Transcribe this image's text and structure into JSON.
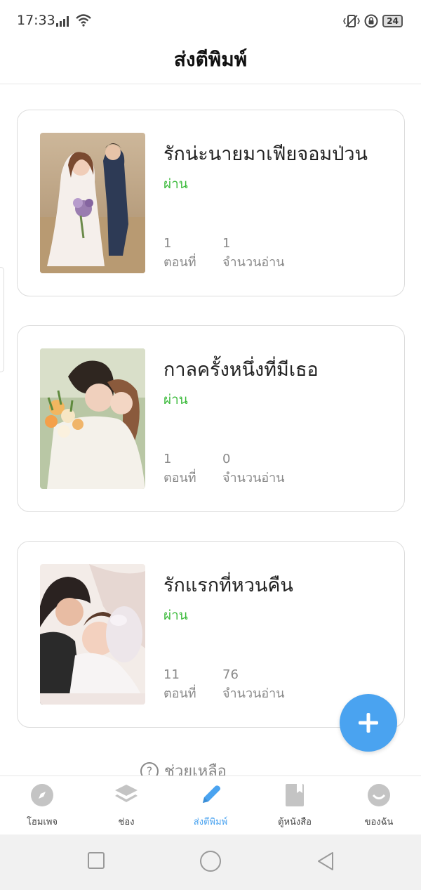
{
  "status_bar": {
    "time": "17:33",
    "battery": "24"
  },
  "header": {
    "title": "ส่งตีพิมพ์"
  },
  "books": [
    {
      "title": "รักน่ะนายมาเฟียจอมป่วน",
      "status": "ผ่าน",
      "chapters": "1",
      "chapters_label": "ตอนที่",
      "reads": "1",
      "reads_label": "จำนวนอ่าน"
    },
    {
      "title": "กาลครั้งหนึ่งที่มีเธอ",
      "status": "ผ่าน",
      "chapters": "1",
      "chapters_label": "ตอนที่",
      "reads": "0",
      "reads_label": "จำนวนอ่าน"
    },
    {
      "title": "รักแรกที่หวนคืน",
      "status": "ผ่าน",
      "chapters": "11",
      "chapters_label": "ตอนที่",
      "reads": "76",
      "reads_label": "จำนวนอ่าน"
    }
  ],
  "help": {
    "label": "ช่วยเหลือ",
    "icon_glyph": "?"
  },
  "fab": {
    "icon": "plus-icon"
  },
  "bottom_nav": {
    "items": [
      {
        "label": "โฮมเพจ",
        "icon": "compass-icon"
      },
      {
        "label": "ช่อง",
        "icon": "layers-icon"
      },
      {
        "label": "ส่งตีพิมพ์",
        "icon": "pen-icon"
      },
      {
        "label": "ตู้หนังสือ",
        "icon": "book-icon"
      },
      {
        "label": "ของฉัน",
        "icon": "smile-icon"
      }
    ],
    "active_index": 2
  },
  "colors": {
    "accent": "#4aa3f0",
    "status_pass": "#3dbb3d",
    "nav_icon_inactive": "#c4c4c4"
  }
}
